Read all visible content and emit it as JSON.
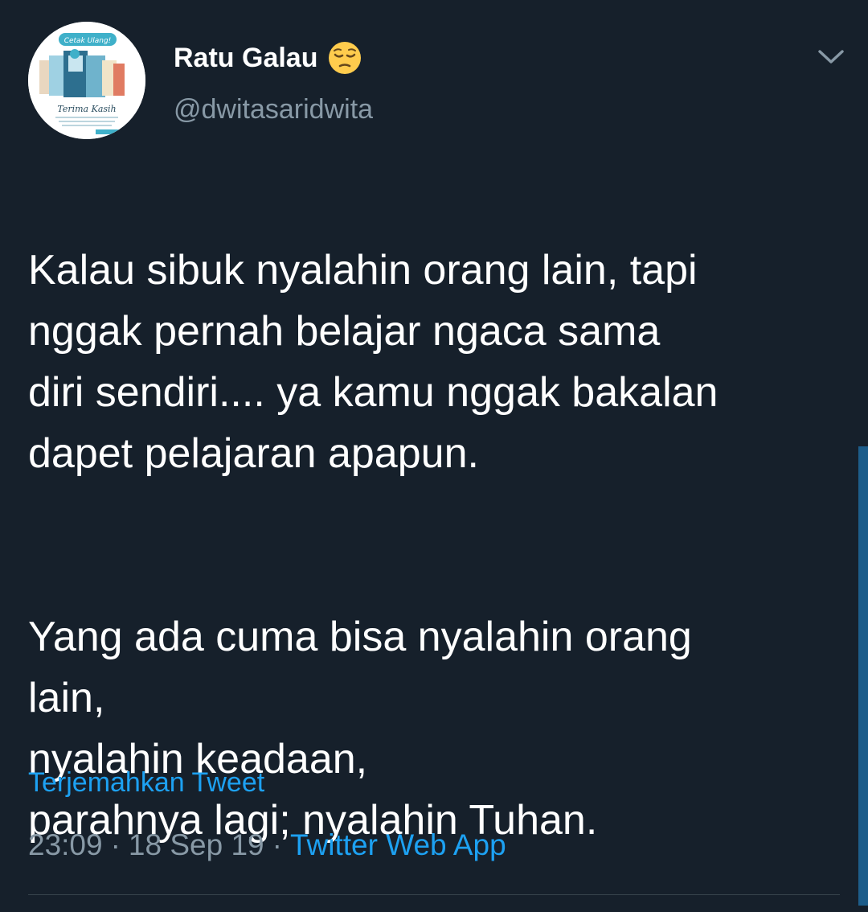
{
  "tweet": {
    "display_name": "Ratu Galau",
    "handle": "@dwitasaridwita",
    "avatar": {
      "banner_text": "Cetak Ulang!",
      "caption": "Terima Kasih"
    },
    "paragraphs": [
      "Kalau sibuk nyalahin orang lain, tapi\nnggak pernah belajar ngaca sama\ndiri sendiri.... ya kamu nggak bakalan\ndapet pelajaran apapun.",
      "Yang ada cuma bisa nyalahin orang\nlain,\nnyalahin keadaan,\nparahnya lagi; nyalahin Tuhan."
    ],
    "translate_label": "Terjemahkan Tweet",
    "time": "23:09",
    "date": "18 Sep 19",
    "separator": "·",
    "source": "Twitter Web App"
  },
  "colors": {
    "background": "#16202b",
    "text": "#ffffff",
    "secondary": "#8899a6",
    "accent": "#1da1f2",
    "divider": "#38444d"
  },
  "icons": {
    "emoji": "pensive-face-emoji",
    "menu": "chevron-down-icon"
  }
}
